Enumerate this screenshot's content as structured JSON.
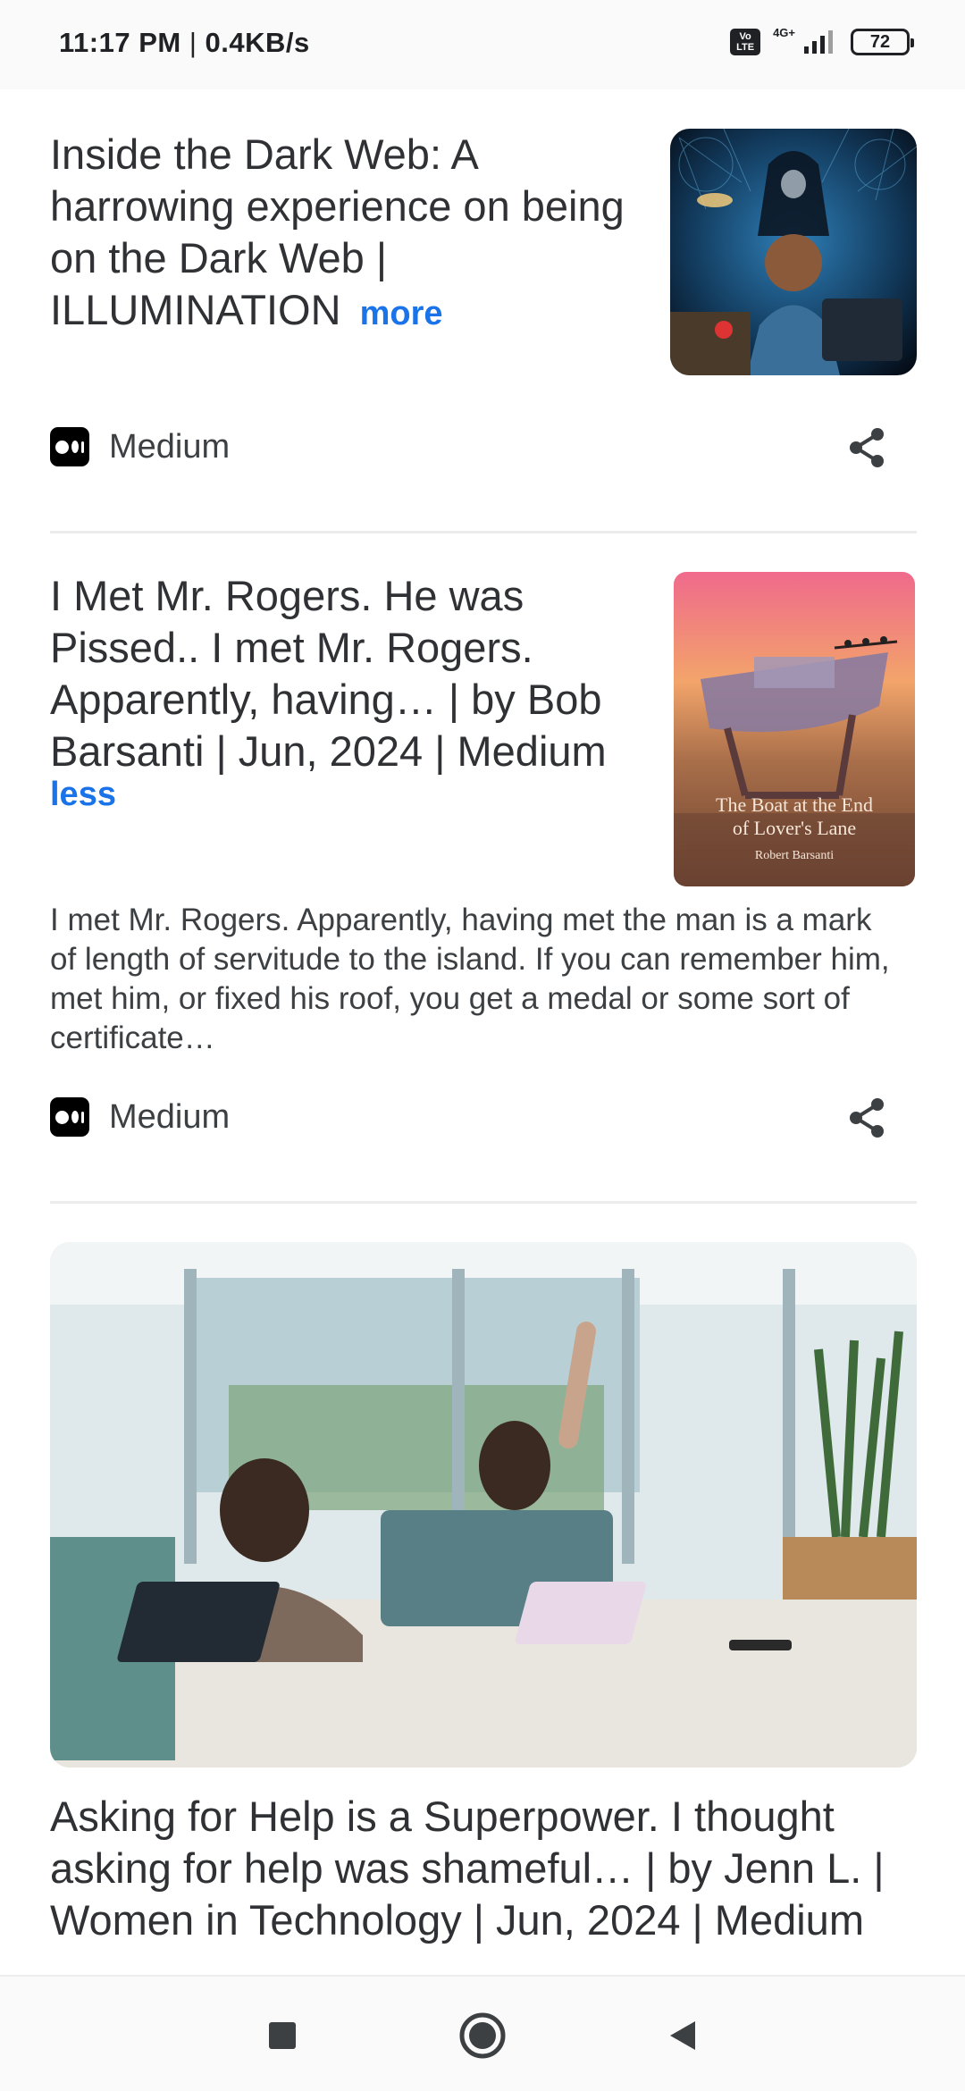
{
  "status_bar": {
    "time": "11:17 PM",
    "speed": "0.4KB/s",
    "volte_label": "Vo LTE",
    "network_type": "4G+",
    "battery_level": "72"
  },
  "feed": {
    "cards": [
      {
        "title": "Inside the Dark Web: A harrowing experience on being on the Dark Web | ILLUMINATION",
        "toggle_label": "more",
        "source": "Medium"
      },
      {
        "title": "I Met Mr. Rogers. He was Pissed.. I met Mr. Rogers. Apparently, having… | by Bob Barsanti | Jun, 2024 | Medium",
        "toggle_label": "less",
        "snippet": "I met Mr. Rogers. Apparently, having met the man is a mark of length of servitude to the island. If you can remember him, met him, or fixed his roof, you get a medal or some sort of certificate…",
        "thumbnail_text": {
          "line1": "The Boat at the End",
          "line2": "of Lover's Lane",
          "author": "Robert Barsanti"
        },
        "source": "Medium"
      },
      {
        "title": "Asking for Help is a Superpower. I thought asking for help was shameful… | by Jenn L. | Women in Technology | Jun, 2024 | Medium"
      }
    ]
  },
  "colors": {
    "accent": "#1a73e8",
    "title": "#303134",
    "divider": "#ececec"
  }
}
